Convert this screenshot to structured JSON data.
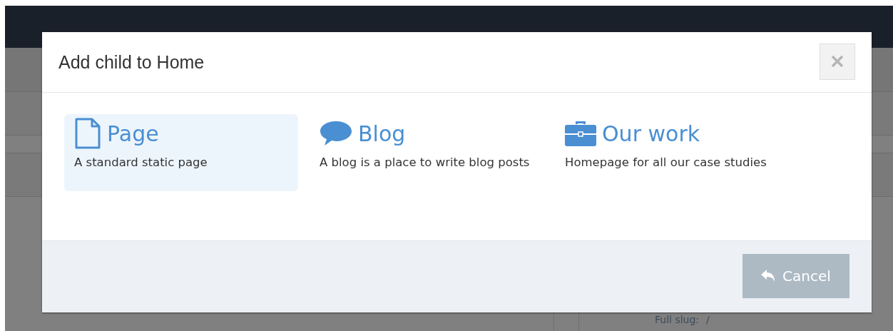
{
  "background": {
    "slug_label": "Full slug:",
    "slug_value": "/"
  },
  "dialog": {
    "title": "Add child to Home",
    "options": [
      {
        "kind": "page",
        "title": "Page",
        "description": "A standard static page",
        "selected": true
      },
      {
        "kind": "blog",
        "title": "Blog",
        "description": "A blog is a place to write blog posts",
        "selected": false
      },
      {
        "kind": "work",
        "title": "Our work",
        "description": "Homepage for all our case studies",
        "selected": false
      }
    ],
    "cancel": "Cancel"
  }
}
